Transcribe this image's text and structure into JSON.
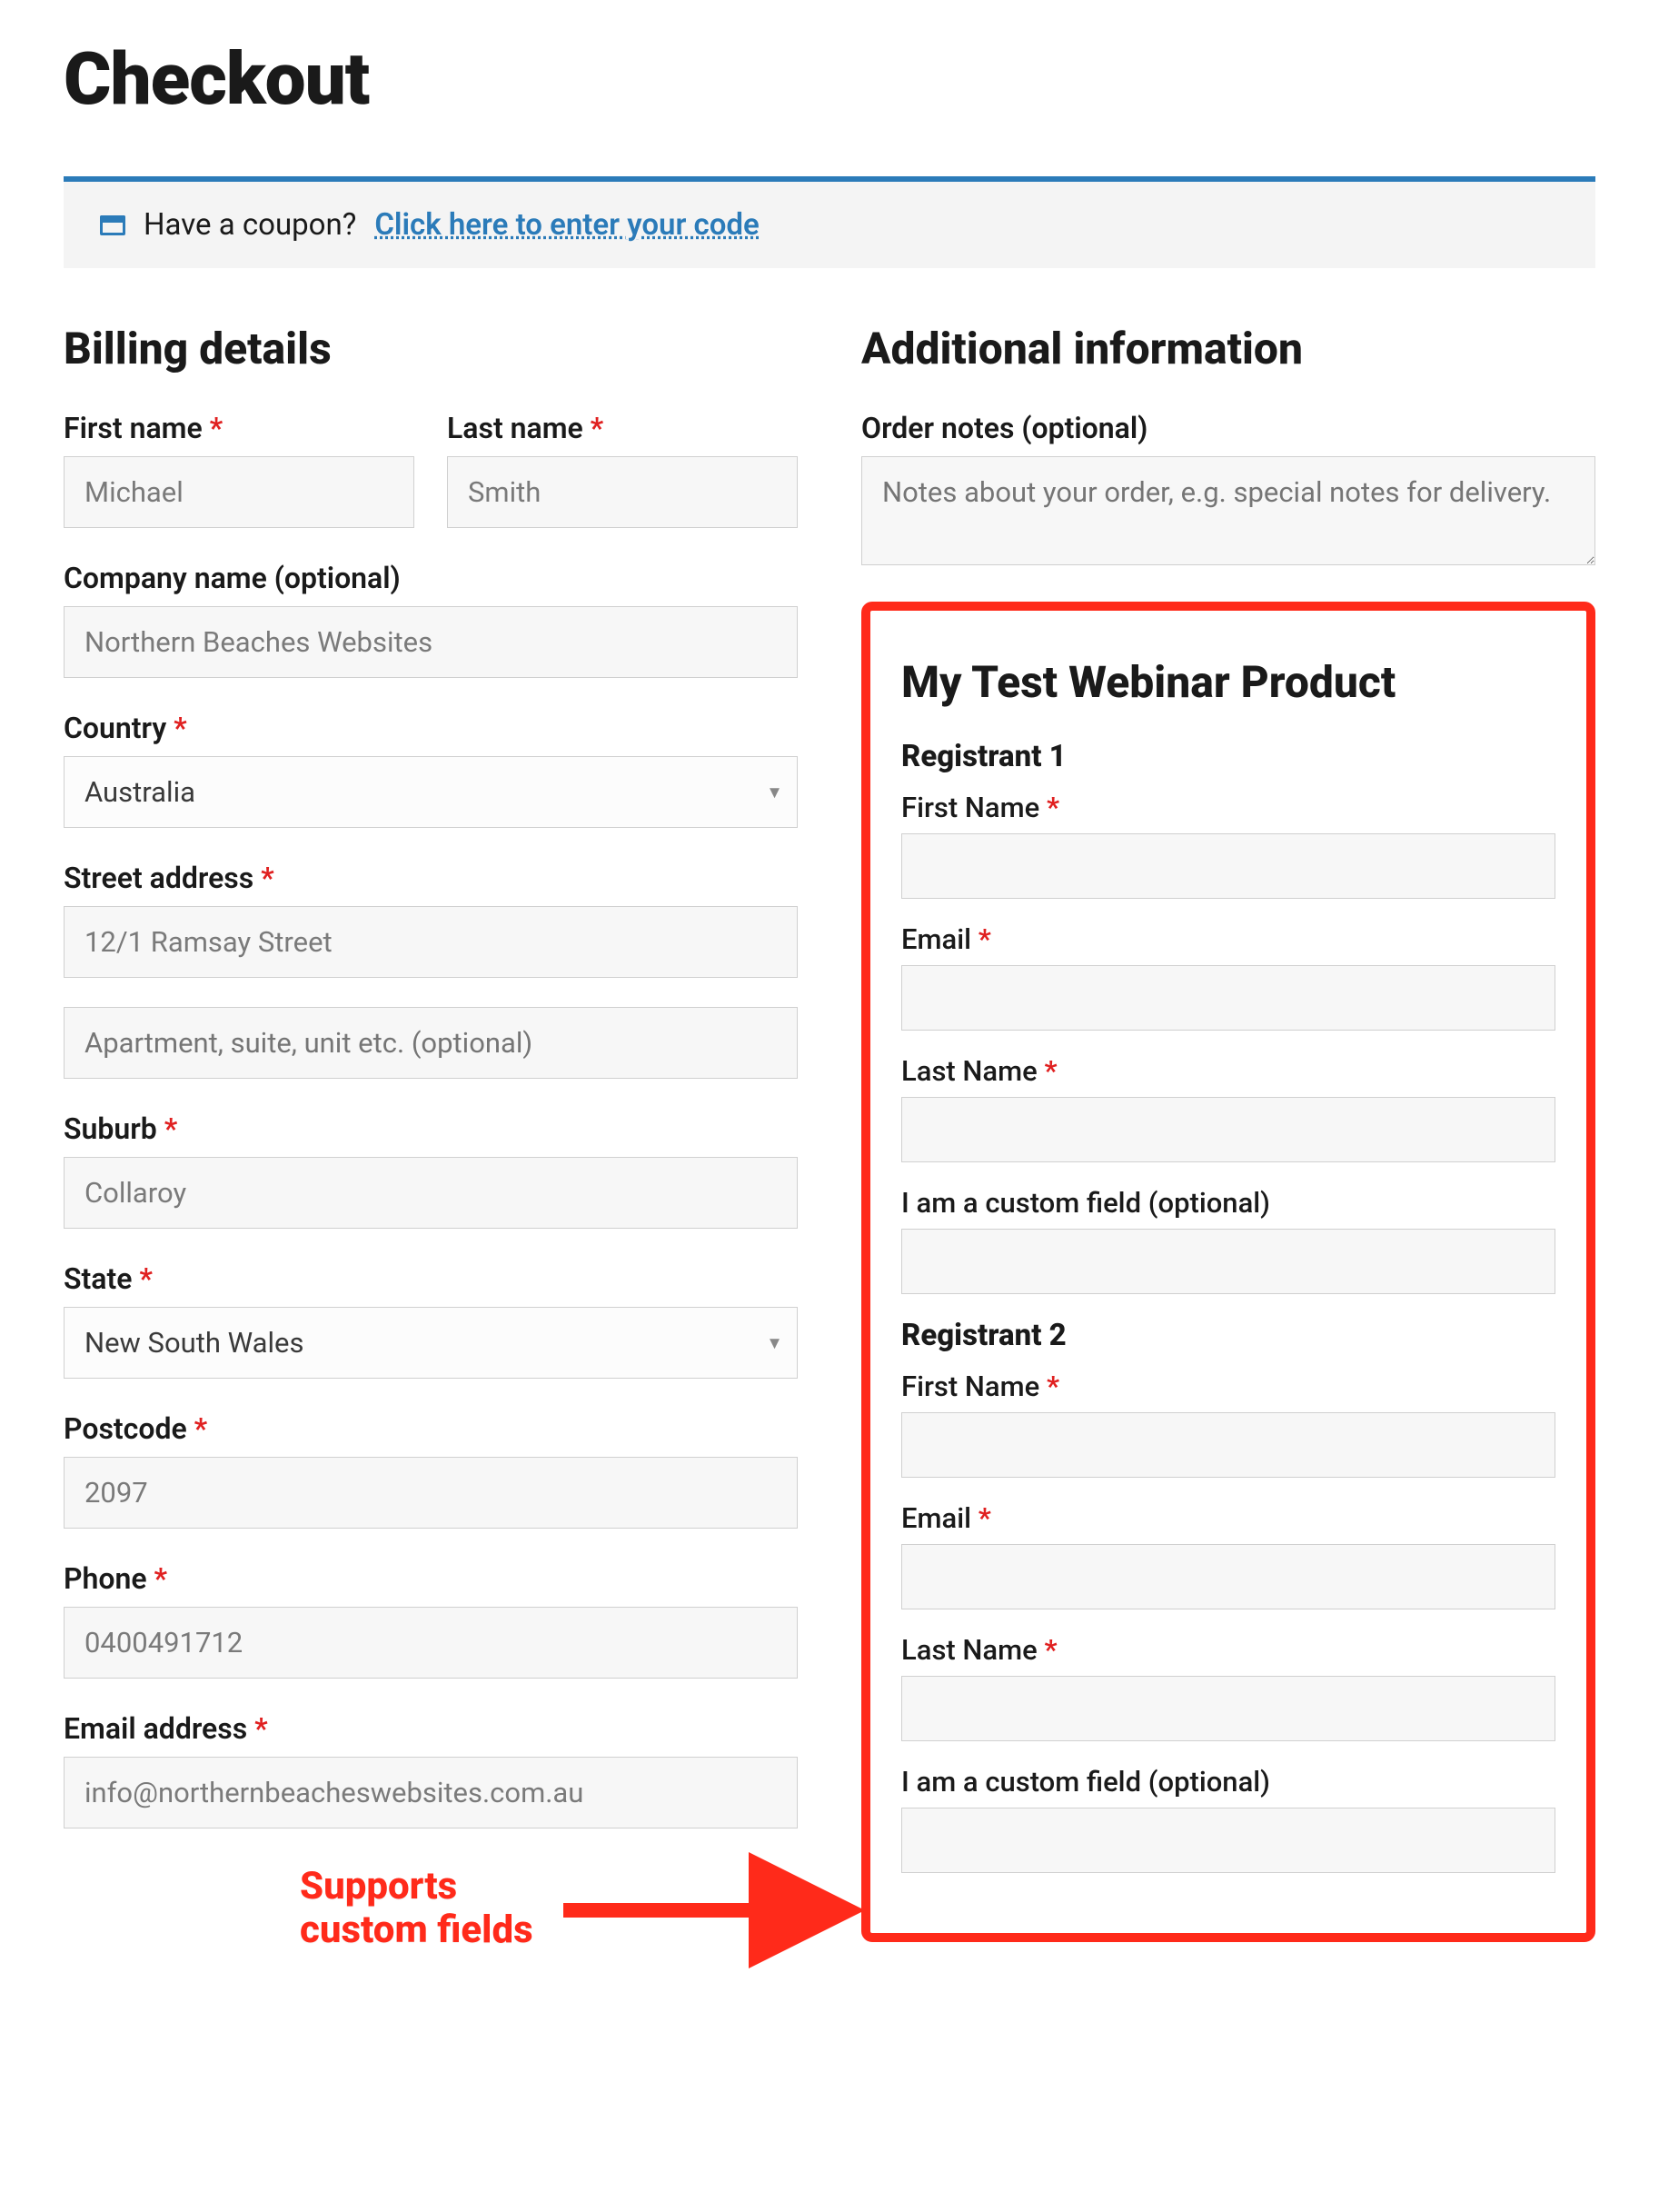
{
  "page_title": "Checkout",
  "coupon": {
    "prompt": "Have a coupon?",
    "link_text": "Click here to enter your code"
  },
  "billing": {
    "heading": "Billing details",
    "first_name": {
      "label": "First name",
      "required": "*",
      "value": "Michael"
    },
    "last_name": {
      "label": "Last name",
      "required": "*",
      "value": "Smith"
    },
    "company": {
      "label": "Company name (optional)",
      "value": "Northern Beaches Websites"
    },
    "country": {
      "label": "Country",
      "required": "*",
      "value": "Australia"
    },
    "address": {
      "label": "Street address",
      "required": "*",
      "line1": "12/1 Ramsay Street",
      "line2_placeholder": "Apartment, suite, unit etc. (optional)"
    },
    "suburb": {
      "label": "Suburb",
      "required": "*",
      "value": "Collaroy"
    },
    "state": {
      "label": "State",
      "required": "*",
      "value": "New South Wales"
    },
    "postcode": {
      "label": "Postcode",
      "required": "*",
      "value": "2097"
    },
    "phone": {
      "label": "Phone",
      "required": "*",
      "value": "0400491712"
    },
    "email": {
      "label": "Email address",
      "required": "*",
      "value": "info@northernbeacheswebsites.com.au"
    }
  },
  "additional": {
    "heading": "Additional information",
    "order_notes": {
      "label": "Order notes (optional)",
      "placeholder": "Notes about your order, e.g. special notes for delivery."
    }
  },
  "product": {
    "title": "My Test Webinar Product",
    "registrants": [
      {
        "heading": "Registrant 1",
        "first_name_label": "First Name",
        "email_label": "Email",
        "last_name_label": "Last Name",
        "custom_label": "I am a custom field (optional)",
        "required": "*"
      },
      {
        "heading": "Registrant 2",
        "first_name_label": "First Name",
        "email_label": "Email",
        "last_name_label": "Last Name",
        "custom_label": "I am a custom field (optional)",
        "required": "*"
      }
    ]
  },
  "annotation": {
    "line1": "Supports",
    "line2": "custom fields"
  }
}
